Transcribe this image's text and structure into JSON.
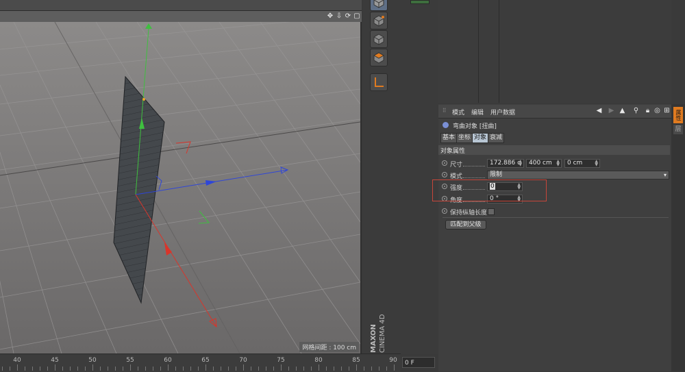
{
  "viewport": {
    "grid_spacing_label": "网格间距 : 100 cm",
    "header_icons": [
      "move-icon",
      "arrow-down-icon",
      "rotate-icon",
      "maximize-icon"
    ]
  },
  "timeline": {
    "ticks": [
      "40",
      "45",
      "50",
      "55",
      "60",
      "65",
      "70",
      "75",
      "80",
      "85",
      "90"
    ],
    "current_frame": "0 F"
  },
  "toolbar": {
    "tools": [
      "cube-icon",
      "cube-edit-icon",
      "cube-points-icon",
      "cube-polygons-icon",
      "axis-icon"
    ],
    "logo_brand": "MAXON",
    "logo_product": "CINEMA 4D"
  },
  "attributes": {
    "menu": [
      "模式",
      "编辑",
      "用户数据"
    ],
    "object_title": "弯曲对象 [扭曲]",
    "tabs": [
      "基本",
      "坐标",
      "对象",
      "衰减"
    ],
    "active_tab": "对象",
    "section_title": "对象属性",
    "size_label": "尺寸",
    "size_values": [
      "172.886 c",
      "400 cm",
      "0 cm"
    ],
    "mode_label": "模式",
    "mode_value": "限制",
    "strength_label": "强度",
    "strength_value": "0",
    "angle_label": "角度",
    "angle_value": "0 °",
    "keep_length_label": "保持纵轴长度",
    "match_button": "匹配到父级"
  },
  "side_tabs": {
    "attributes": "属性",
    "layers": "层"
  },
  "colors": {
    "accent": "#e07b20",
    "highlight_box": "#c8463a",
    "axis_x": "#d9352b",
    "axis_y": "#3fbf3f",
    "axis_z": "#2f46d8"
  }
}
